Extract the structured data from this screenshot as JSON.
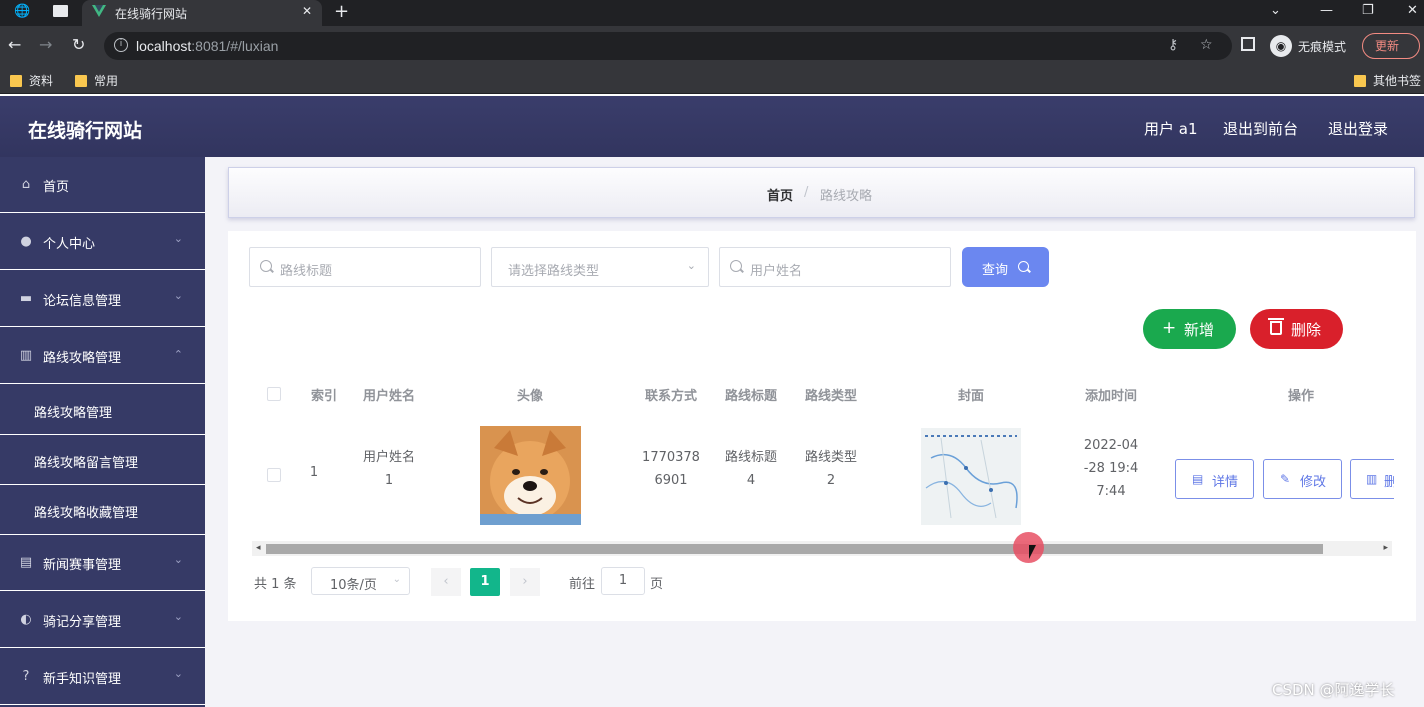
{
  "browser": {
    "tab_title": "在线骑行网站",
    "url_host": "localhost",
    "url_rest": ":8081/#/luxian",
    "incognito_label": "无痕模式",
    "update_label": "更新",
    "bookmarks": [
      "资料",
      "常用"
    ],
    "other_bookmarks": "其他书签"
  },
  "header": {
    "app_title": "在线骑行网站",
    "user_label": "用户 a1",
    "back_frontend": "退出到前台",
    "logout": "退出登录"
  },
  "sidebar": {
    "items": [
      {
        "label": "首页",
        "icon": "home-icon"
      },
      {
        "label": "个人中心",
        "icon": "user-icon"
      },
      {
        "label": "论坛信息管理",
        "icon": "briefcase-icon"
      },
      {
        "label": "路线攻略管理",
        "icon": "book-icon"
      },
      {
        "label": "新闻赛事管理",
        "icon": "message-icon"
      },
      {
        "label": "骑记分享管理",
        "icon": "bulb-icon"
      },
      {
        "label": "新手知识管理",
        "icon": "help-icon"
      }
    ],
    "subitems": [
      "路线攻略管理",
      "路线攻略留言管理",
      "路线攻略收藏管理"
    ]
  },
  "breadcrumb": {
    "home": "首页",
    "separator": "/",
    "current": "路线攻略"
  },
  "search": {
    "title_placeholder": "路线标题",
    "type_placeholder": "请选择路线类型",
    "name_placeholder": "用户姓名",
    "query_label": "查询"
  },
  "actions": {
    "add_label": "新增",
    "delete_label": "删除"
  },
  "table": {
    "columns": [
      "索引",
      "用户姓名",
      "头像",
      "联系方式",
      "路线标题",
      "路线类型",
      "封面",
      "添加时间",
      "操作"
    ],
    "rows": [
      {
        "index": "1",
        "name_line1": "用户姓名",
        "name_line2": "1",
        "phone_line1": "1770378",
        "phone_line2": "6901",
        "title_line1": "路线标题",
        "title_line2": "4",
        "type_line1": "路线类型",
        "type_line2": "2",
        "time_line1": "2022-04",
        "time_line2": "-28 19:4",
        "time_line3": "7:44",
        "detail_label": "详情",
        "edit_label": "修改",
        "delete_label": "删"
      }
    ]
  },
  "pagination": {
    "total": "共 1 条",
    "page_size": "10条/页",
    "current_page": "1",
    "goto_prefix": "前往",
    "goto_value": "1",
    "goto_suffix": "页"
  },
  "watermark": "CSDN @阿逸学长",
  "colors": {
    "header": "#3a3d6b",
    "sidebar": "#363a66",
    "primary": "#6b87f0",
    "success": "#1aa94e",
    "danger": "#d9202b",
    "page_active": "#12b68b"
  }
}
